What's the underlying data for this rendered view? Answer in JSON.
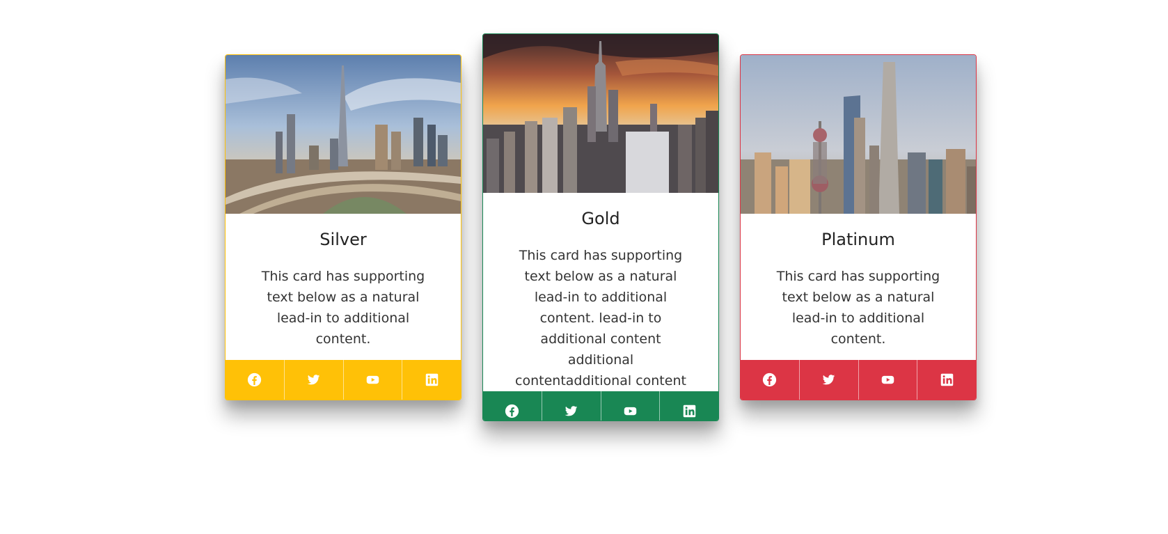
{
  "cards": [
    {
      "title": "Silver",
      "text": "This card has supporting text below as a natural lead-in to additional content.",
      "accent_color": "#ffc107",
      "image": "city-skyline-photo-dubai",
      "social": [
        "facebook-icon",
        "twitter-icon",
        "youtube-icon",
        "linkedin-icon"
      ]
    },
    {
      "title": "Gold",
      "text": "This card has supporting text below as a natural lead-in to additional content. lead-in to additional content additional contentadditional content",
      "accent_color": "#198754",
      "image": "city-skyline-photo-new-york",
      "social": [
        "facebook-icon",
        "twitter-icon",
        "youtube-icon",
        "linkedin-icon"
      ]
    },
    {
      "title": "Platinum",
      "text": "This card has supporting text below as a natural lead-in to additional content.",
      "accent_color": "#dc3545",
      "image": "city-skyline-photo-shanghai",
      "social": [
        "facebook-icon",
        "twitter-icon",
        "youtube-icon",
        "linkedin-icon"
      ]
    }
  ]
}
